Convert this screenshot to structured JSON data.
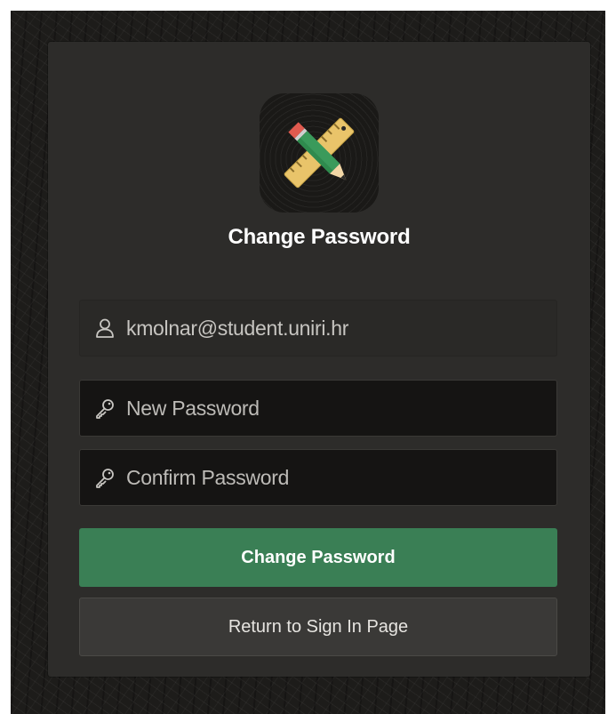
{
  "app": {
    "logo_icon": "ruler-pencil-icon"
  },
  "form": {
    "title": "Change Password",
    "username": {
      "icon": "user-icon",
      "value": "kmolnar@student.uniri.hr"
    },
    "new_password": {
      "icon": "key-icon",
      "placeholder": "New Password",
      "value": ""
    },
    "confirm_password": {
      "icon": "key-icon",
      "placeholder": "Confirm Password",
      "value": ""
    },
    "submit_label": "Change Password",
    "return_label": "Return to Sign In Page"
  },
  "colors": {
    "primary_button": "#3a7f55",
    "background": "#1d1c1a",
    "card": "#2d2c2a"
  }
}
